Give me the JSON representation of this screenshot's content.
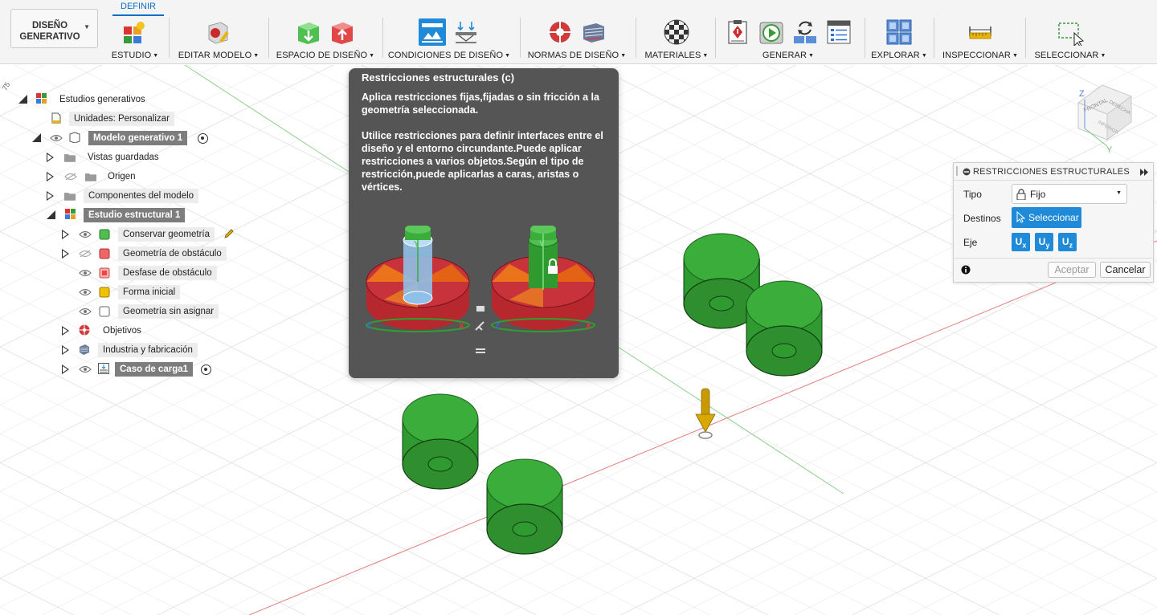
{
  "workspace": {
    "label": "DISEÑO\nGENERATIVO"
  },
  "active_tab": "DEFINIR",
  "toolbar": {
    "groups": [
      {
        "label": "ESTUDIO"
      },
      {
        "label": "EDITAR MODELO"
      },
      {
        "label": "ESPACIO DE DISEÑO"
      },
      {
        "label": "CONDICIONES DE DISEÑO"
      },
      {
        "label": "NORMAS DE DISEÑO"
      },
      {
        "label": "MATERIALES"
      },
      {
        "label": "GENERAR"
      },
      {
        "label": "EXPLORAR"
      },
      {
        "label": "INSPECCIONAR"
      },
      {
        "label": "SELECCIONAR"
      }
    ]
  },
  "tree": {
    "root": "Estudios generativos",
    "units": "Unidades: Personalizar",
    "model": "Modelo generativo 1",
    "saved_views": "Vistas guardadas",
    "origin": "Origen",
    "components": "Componentes del modelo",
    "study": "Estudio estructural 1",
    "preserve": "Conservar geometría",
    "obstacle": "Geometría de obstáculo",
    "obstacle_offset": "Desfase de obstáculo",
    "starting_shape": "Forma inicial",
    "unassigned": "Geometría sin asignar",
    "objectives": "Objetivos",
    "manufacturing": "Industria y fabricación",
    "load_case": "Caso de carga1"
  },
  "tooltip": {
    "title": "Restricciones estructurales (c)",
    "p1": "Aplica restricciones fijas,fijadas o sin fricción a la geometría seleccionada.",
    "p2": "Utilice restricciones para definir interfaces entre el diseño y el entorno circundante.Puede aplicar restricciones a varios objetos.Según el tipo de restricción,puede aplicarlas a caras, aristas o vértices."
  },
  "panel": {
    "title": "RESTRICCIONES ESTRUCTURALES",
    "type_label": "Tipo",
    "type_value": "Fijo",
    "targets_label": "Destinos",
    "select_button": "Seleccionar",
    "axis_label": "Eje",
    "axes": [
      "x",
      "y",
      "z"
    ],
    "axis_prefix": "U",
    "ok": "Aceptar",
    "cancel": "Cancelar"
  },
  "viewcube": {
    "front": "FRONTAL",
    "right": "DERECHA",
    "bottom": "INFERIOR",
    "z": "Z",
    "y": "Y"
  },
  "ruler_tick": "75",
  "colors": {
    "accent": "#1e8ad8",
    "tab": "#0b6fc9",
    "tooltip_bg": "#555555",
    "part_green": "#2f9a2f"
  }
}
